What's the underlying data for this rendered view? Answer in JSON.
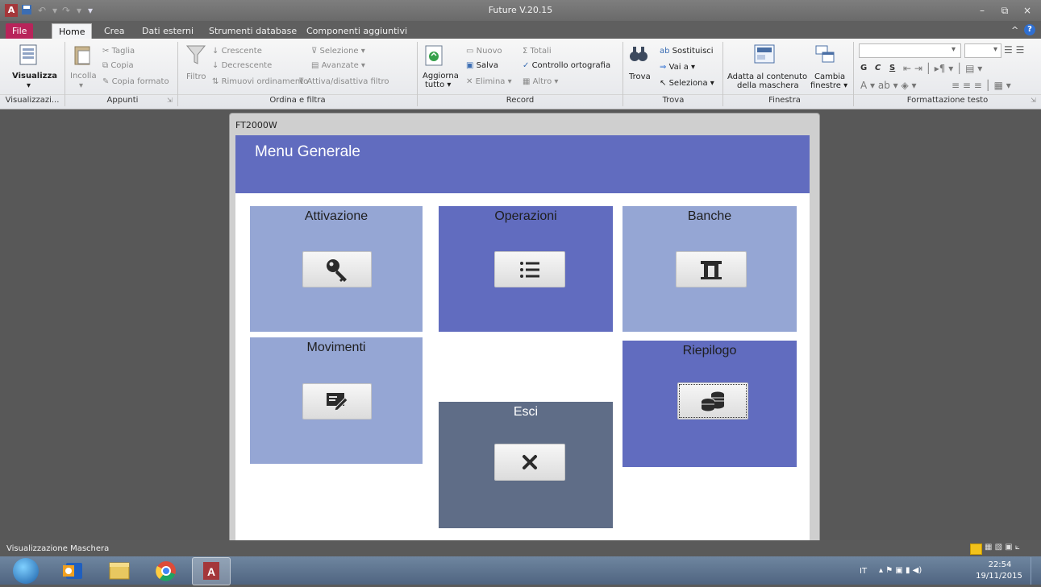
{
  "window": {
    "title": "Future V.20.15",
    "minimize": "–",
    "restore": "⧉",
    "close": "×",
    "help": "?",
    "collapse": "^",
    "app_letter": "A"
  },
  "ribbon_tabs": [
    "File",
    "Home",
    "Crea",
    "Dati esterni",
    "Strumenti database",
    "Componenti aggiuntivi"
  ],
  "active_tab": "Home",
  "ribbon": {
    "visualizza": {
      "button": "Visualizza",
      "group": "Visualizzazi..."
    },
    "appunti": {
      "incolla": "Incolla",
      "taglia": "Taglia",
      "copia": "Copia",
      "copia_formato": "Copia formato",
      "group": "Appunti"
    },
    "ordina": {
      "filtro": "Filtro",
      "crescente": "Crescente",
      "decrescente": "Decrescente",
      "rimuovi": "Rimuovi ordinamento",
      "selezione": "Selezione",
      "avanzate": "Avanzate",
      "attiva": "Attiva/disattiva filtro",
      "group": "Ordina e filtra"
    },
    "record": {
      "aggiorna": "Aggiorna",
      "tutto": "tutto",
      "nuovo": "Nuovo",
      "salva": "Salva",
      "elimina": "Elimina",
      "totali": "Totali",
      "controllo": "Controllo ortografia",
      "altro": "Altro",
      "group": "Record"
    },
    "trova": {
      "trova": "Trova",
      "sostituisci": "Sostituisci",
      "vai": "Vai a",
      "seleziona": "Seleziona",
      "group": "Trova"
    },
    "finestra": {
      "adatta1": "Adatta al contenuto",
      "adatta2": "della maschera",
      "cambia1": "Cambia",
      "cambia2": "finestre",
      "group": "Finestra"
    },
    "formattazione": {
      "bold": "G",
      "italic": "C",
      "underline": "S",
      "font_color": "A",
      "group": "Formattazione testo"
    }
  },
  "form": {
    "caption": "FT2000W",
    "title": "Menu Generale",
    "tiles": [
      {
        "label": "Attivazione",
        "color": "#95a6d4",
        "icon": "key-icon"
      },
      {
        "label": "Operazioni",
        "color": "#616cbf",
        "icon": "list-icon"
      },
      {
        "label": "Banche",
        "color": "#95a6d4",
        "icon": "bank-icon"
      },
      {
        "label": "Movimenti",
        "color": "#95a6d4",
        "icon": "edit-icon"
      },
      {
        "label": "Esci",
        "color": "#5f6d87",
        "icon": "close-icon"
      },
      {
        "label": "Riepilogo",
        "color": "#616cbf",
        "icon": "coins-icon"
      }
    ]
  },
  "status": {
    "text": "Visualizzazione Maschera"
  },
  "taskbar": {
    "language": "IT",
    "time": "22:54",
    "date": "19/11/2015"
  }
}
